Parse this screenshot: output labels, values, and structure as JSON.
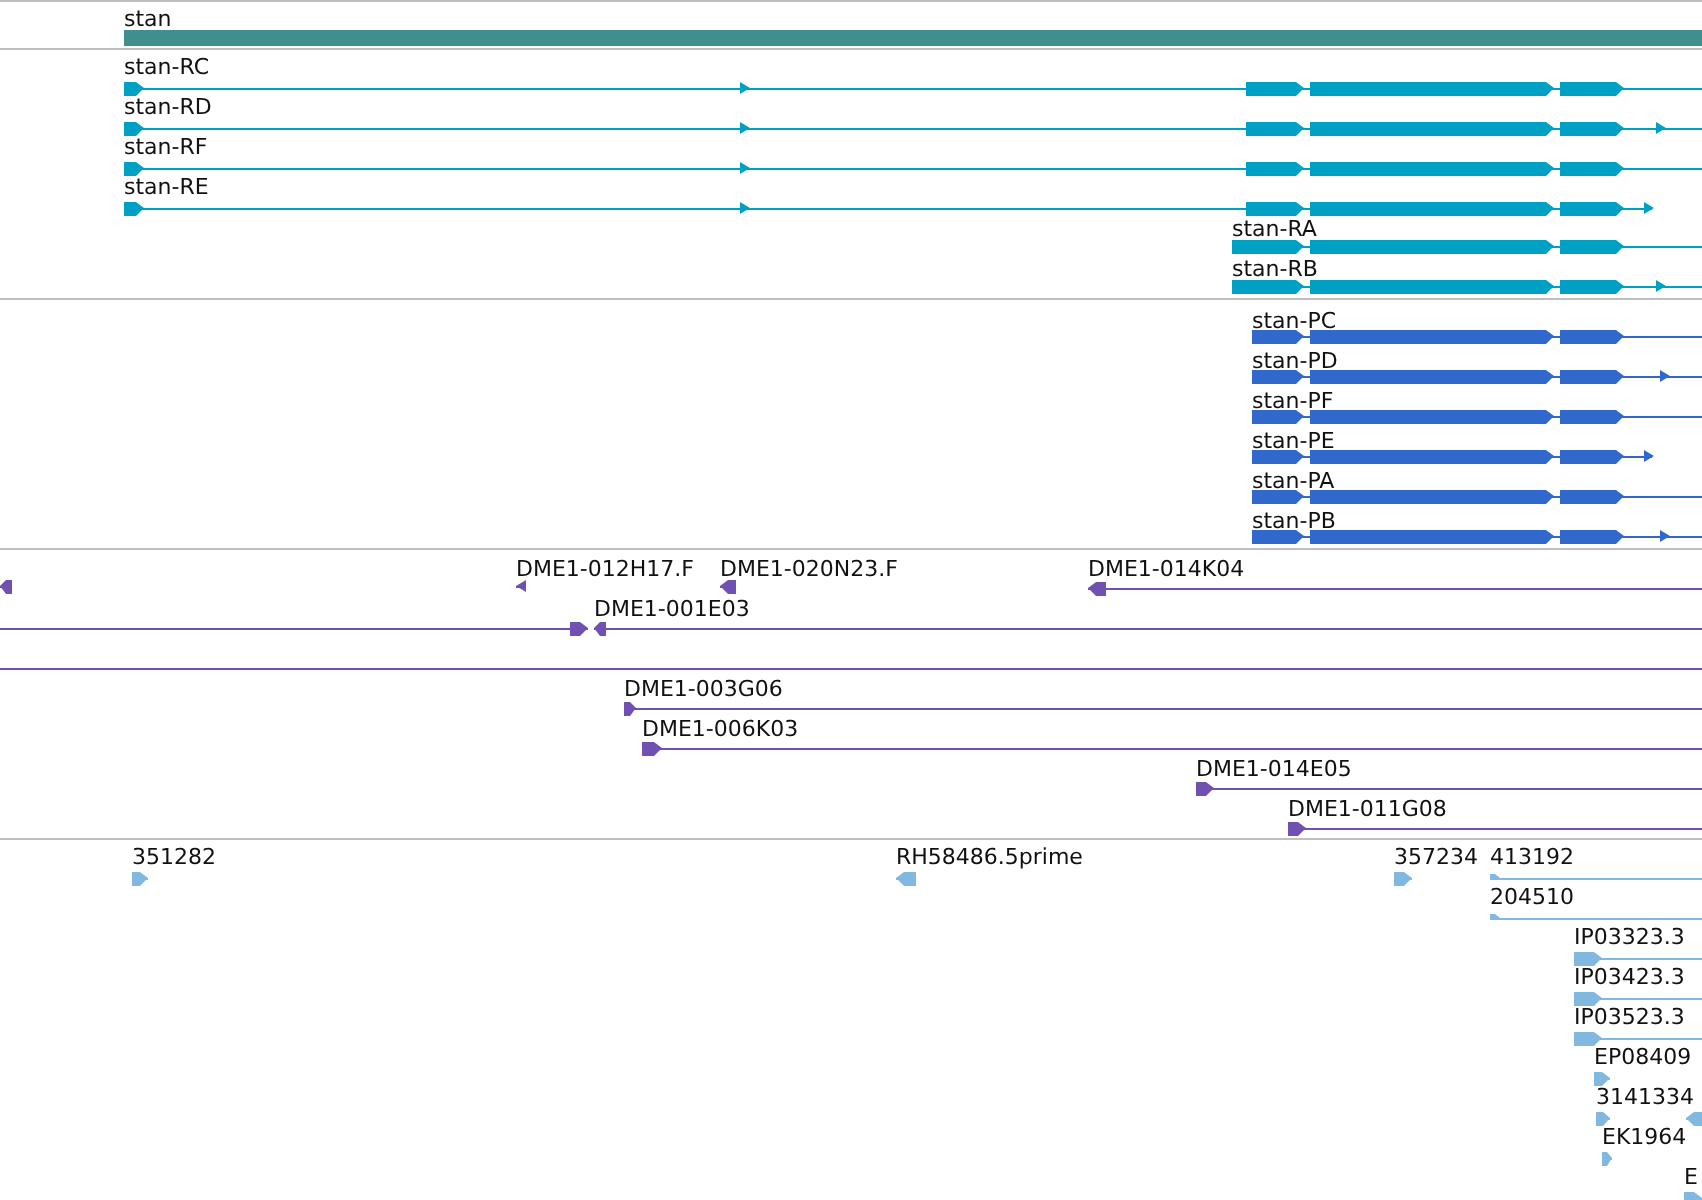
{
  "tracks": [
    {
      "kind": "gene",
      "color": "#3f8f8f",
      "features": [
        {
          "label": "stan"
        }
      ]
    },
    {
      "kind": "transcript",
      "color": "#00a0c4",
      "features": [
        {
          "label": "stan-RC"
        },
        {
          "label": "stan-RD"
        },
        {
          "label": "stan-RF"
        },
        {
          "label": "stan-RE"
        },
        {
          "label": "stan-RA"
        },
        {
          "label": "stan-RB"
        }
      ]
    },
    {
      "kind": "transcript",
      "color": "#3068cc",
      "features": [
        {
          "label": "stan-PC"
        },
        {
          "label": "stan-PD"
        },
        {
          "label": "stan-PF"
        },
        {
          "label": "stan-PE"
        },
        {
          "label": "stan-PA"
        },
        {
          "label": "stan-PB"
        }
      ]
    },
    {
      "kind": "clone",
      "color": "#7050b0",
      "features": [
        {
          "label": "DME1-012H17.F"
        },
        {
          "label": "DME1-020N23.F"
        },
        {
          "label": "DME1-014K04"
        },
        {
          "label": "DME1-001E03"
        },
        {
          "label": "DME1-003G06"
        },
        {
          "label": "DME1-006K03"
        },
        {
          "label": "DME1-014E05"
        },
        {
          "label": "DME1-011G08"
        }
      ]
    },
    {
      "kind": "est",
      "color": "#80b8e0",
      "features": [
        {
          "label": "351282"
        },
        {
          "label": "RH58486.5prime"
        },
        {
          "label": "357234"
        },
        {
          "label": "413192"
        },
        {
          "label": "204510"
        },
        {
          "label": "IP03323.3"
        },
        {
          "label": "IP03423.3"
        },
        {
          "label": "IP03523.3"
        },
        {
          "label": "EP08409"
        },
        {
          "label": "3141334"
        },
        {
          "label": "EK1964"
        },
        {
          "label": "E"
        }
      ]
    }
  ]
}
